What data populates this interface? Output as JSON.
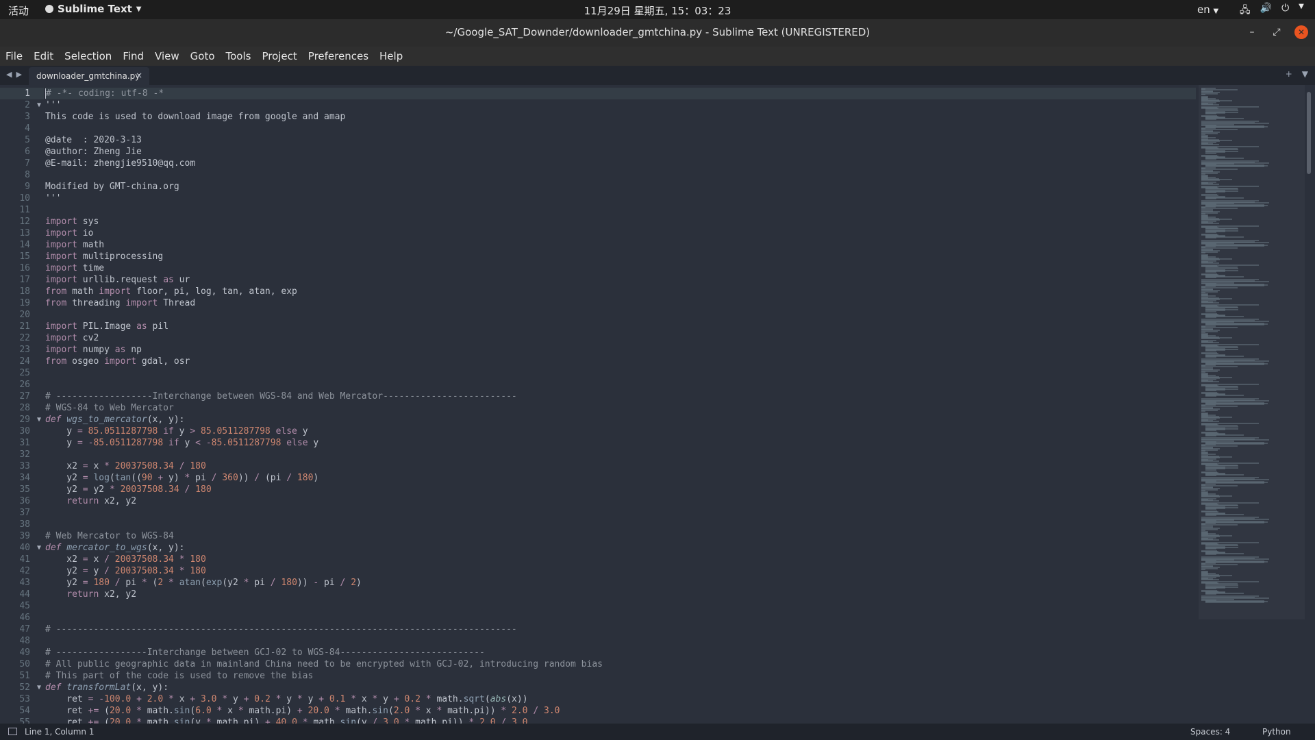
{
  "topbar": {
    "activities": "活动",
    "app_name": "Sublime Text",
    "clock": "11月29日 星期五, 15：03：23",
    "language": "en"
  },
  "window": {
    "title": "~/Google_SAT_Downder/downloader_gmtchina.py - Sublime Text (UNREGISTERED)"
  },
  "menu": [
    "File",
    "Edit",
    "Selection",
    "Find",
    "View",
    "Goto",
    "Tools",
    "Project",
    "Preferences",
    "Help"
  ],
  "tabs": [
    {
      "label": "downloader_gmtchina.py",
      "close": "×"
    }
  ],
  "statusbar": {
    "position": "Line 1, Column 1",
    "indent": "Spaces: 4",
    "syntax": "Python"
  },
  "editor": {
    "active_line": 1,
    "fold_lines": [
      2,
      29,
      40,
      52
    ],
    "lines": [
      [
        [
          "comment",
          "# -*- coding: utf-8 -*"
        ]
      ],
      [
        [
          "text",
          "'''"
        ]
      ],
      [
        [
          "text",
          "This code is used to download image from google and amap"
        ]
      ],
      [],
      [
        [
          "text",
          "@date  : 2020-3-13"
        ]
      ],
      [
        [
          "text",
          "@author: Zheng Jie"
        ]
      ],
      [
        [
          "text",
          "@E-mail: zhengjie9510@qq.com"
        ]
      ],
      [],
      [
        [
          "text",
          "Modified by GMT-china.org"
        ]
      ],
      [
        [
          "text",
          "'''"
        ]
      ],
      [],
      [
        [
          "kw",
          "import"
        ],
        [
          "text",
          " sys"
        ]
      ],
      [
        [
          "kw",
          "import"
        ],
        [
          "text",
          " io"
        ]
      ],
      [
        [
          "kw",
          "import"
        ],
        [
          "text",
          " math"
        ]
      ],
      [
        [
          "kw",
          "import"
        ],
        [
          "text",
          " multiprocessing"
        ]
      ],
      [
        [
          "kw",
          "import"
        ],
        [
          "text",
          " time"
        ]
      ],
      [
        [
          "kw",
          "import"
        ],
        [
          "text",
          " urllib.request "
        ],
        [
          "kw",
          "as"
        ],
        [
          "text",
          " ur"
        ]
      ],
      [
        [
          "kw",
          "from"
        ],
        [
          "text",
          " math "
        ],
        [
          "kw",
          "import"
        ],
        [
          "text",
          " floor, pi, log, tan, atan, exp"
        ]
      ],
      [
        [
          "kw",
          "from"
        ],
        [
          "text",
          " threading "
        ],
        [
          "kw",
          "import"
        ],
        [
          "text",
          " Thread"
        ]
      ],
      [],
      [
        [
          "kw",
          "import"
        ],
        [
          "text",
          " PIL.Image "
        ],
        [
          "kw",
          "as"
        ],
        [
          "text",
          " pil"
        ]
      ],
      [
        [
          "kw",
          "import"
        ],
        [
          "text",
          " cv2"
        ]
      ],
      [
        [
          "kw",
          "import"
        ],
        [
          "text",
          " numpy "
        ],
        [
          "kw",
          "as"
        ],
        [
          "text",
          " np"
        ]
      ],
      [
        [
          "kw",
          "from"
        ],
        [
          "text",
          " osgeo "
        ],
        [
          "kw",
          "import"
        ],
        [
          "text",
          " gdal, osr"
        ]
      ],
      [],
      [],
      [
        [
          "comment",
          "# ------------------Interchange between WGS-84 and Web Mercator-------------------------"
        ]
      ],
      [
        [
          "comment",
          "# WGS-84 to Web Mercator"
        ]
      ],
      [
        [
          "def",
          "def"
        ],
        [
          "text",
          " "
        ],
        [
          "deffn",
          "wgs_to_mercator"
        ],
        [
          "text",
          "(x, y):"
        ]
      ],
      [
        [
          "text",
          "    y "
        ],
        [
          "kw",
          "="
        ],
        [
          "text",
          " "
        ],
        [
          "num",
          "85.0511287798"
        ],
        [
          "text",
          " "
        ],
        [
          "kw",
          "if"
        ],
        [
          "text",
          " y "
        ],
        [
          "kw",
          ">"
        ],
        [
          "text",
          " "
        ],
        [
          "num",
          "85.0511287798"
        ],
        [
          "text",
          " "
        ],
        [
          "kw",
          "else"
        ],
        [
          "text",
          " y"
        ]
      ],
      [
        [
          "text",
          "    y "
        ],
        [
          "kw",
          "="
        ],
        [
          "text",
          " "
        ],
        [
          "kw",
          "-"
        ],
        [
          "num",
          "85.0511287798"
        ],
        [
          "text",
          " "
        ],
        [
          "kw",
          "if"
        ],
        [
          "text",
          " y "
        ],
        [
          "kw",
          "<"
        ],
        [
          "text",
          " "
        ],
        [
          "kw",
          "-"
        ],
        [
          "num",
          "85.0511287798"
        ],
        [
          "text",
          " "
        ],
        [
          "kw",
          "else"
        ],
        [
          "text",
          " y"
        ]
      ],
      [],
      [
        [
          "text",
          "    x2 "
        ],
        [
          "kw",
          "="
        ],
        [
          "text",
          " x "
        ],
        [
          "kw",
          "*"
        ],
        [
          "text",
          " "
        ],
        [
          "num",
          "20037508.34"
        ],
        [
          "text",
          " "
        ],
        [
          "kw",
          "/"
        ],
        [
          "text",
          " "
        ],
        [
          "num",
          "180"
        ]
      ],
      [
        [
          "text",
          "    y2 "
        ],
        [
          "kw",
          "="
        ],
        [
          "text",
          " "
        ],
        [
          "fn",
          "log"
        ],
        [
          "text",
          "("
        ],
        [
          "fn",
          "tan"
        ],
        [
          "text",
          "(("
        ],
        [
          "num",
          "90"
        ],
        [
          "text",
          " "
        ],
        [
          "kw",
          "+"
        ],
        [
          "text",
          " y) "
        ],
        [
          "kw",
          "*"
        ],
        [
          "text",
          " pi "
        ],
        [
          "kw",
          "/"
        ],
        [
          "text",
          " "
        ],
        [
          "num",
          "360"
        ],
        [
          "text",
          ")) "
        ],
        [
          "kw",
          "/"
        ],
        [
          "text",
          " (pi "
        ],
        [
          "kw",
          "/"
        ],
        [
          "text",
          " "
        ],
        [
          "num",
          "180"
        ],
        [
          "text",
          ")"
        ]
      ],
      [
        [
          "text",
          "    y2 "
        ],
        [
          "kw",
          "="
        ],
        [
          "text",
          " y2 "
        ],
        [
          "kw",
          "*"
        ],
        [
          "text",
          " "
        ],
        [
          "num",
          "20037508.34"
        ],
        [
          "text",
          " "
        ],
        [
          "kw",
          "/"
        ],
        [
          "text",
          " "
        ],
        [
          "num",
          "180"
        ]
      ],
      [
        [
          "text",
          "    "
        ],
        [
          "kw",
          "return"
        ],
        [
          "text",
          " x2, y2"
        ]
      ],
      [],
      [],
      [
        [
          "comment",
          "# Web Mercator to WGS-84"
        ]
      ],
      [
        [
          "def",
          "def"
        ],
        [
          "text",
          " "
        ],
        [
          "deffn",
          "mercator_to_wgs"
        ],
        [
          "text",
          "(x, y):"
        ]
      ],
      [
        [
          "text",
          "    x2 "
        ],
        [
          "kw",
          "="
        ],
        [
          "text",
          " x "
        ],
        [
          "kw",
          "/"
        ],
        [
          "text",
          " "
        ],
        [
          "num",
          "20037508.34"
        ],
        [
          "text",
          " "
        ],
        [
          "kw",
          "*"
        ],
        [
          "text",
          " "
        ],
        [
          "num",
          "180"
        ]
      ],
      [
        [
          "text",
          "    y2 "
        ],
        [
          "kw",
          "="
        ],
        [
          "text",
          " y "
        ],
        [
          "kw",
          "/"
        ],
        [
          "text",
          " "
        ],
        [
          "num",
          "20037508.34"
        ],
        [
          "text",
          " "
        ],
        [
          "kw",
          "*"
        ],
        [
          "text",
          " "
        ],
        [
          "num",
          "180"
        ]
      ],
      [
        [
          "text",
          "    y2 "
        ],
        [
          "kw",
          "="
        ],
        [
          "text",
          " "
        ],
        [
          "num",
          "180"
        ],
        [
          "text",
          " "
        ],
        [
          "kw",
          "/"
        ],
        [
          "text",
          " pi "
        ],
        [
          "kw",
          "*"
        ],
        [
          "text",
          " ("
        ],
        [
          "num",
          "2"
        ],
        [
          "text",
          " "
        ],
        [
          "kw",
          "*"
        ],
        [
          "text",
          " "
        ],
        [
          "fn",
          "atan"
        ],
        [
          "text",
          "("
        ],
        [
          "fn",
          "exp"
        ],
        [
          "text",
          "(y2 "
        ],
        [
          "kw",
          "*"
        ],
        [
          "text",
          " pi "
        ],
        [
          "kw",
          "/"
        ],
        [
          "text",
          " "
        ],
        [
          "num",
          "180"
        ],
        [
          "text",
          ")) "
        ],
        [
          "kw",
          "-"
        ],
        [
          "text",
          " pi "
        ],
        [
          "kw",
          "/"
        ],
        [
          "text",
          " "
        ],
        [
          "num",
          "2"
        ],
        [
          "text",
          ")"
        ]
      ],
      [
        [
          "text",
          "    "
        ],
        [
          "kw",
          "return"
        ],
        [
          "text",
          " x2, y2"
        ]
      ],
      [],
      [],
      [
        [
          "comment",
          "# --------------------------------------------------------------------------------------"
        ]
      ],
      [],
      [
        [
          "comment",
          "# -----------------Interchange between GCJ-02 to WGS-84---------------------------"
        ]
      ],
      [
        [
          "comment",
          "# All public geographic data in mainland China need to be encrypted with GCJ-02, introducing random bias"
        ]
      ],
      [
        [
          "comment",
          "# This part of the code is used to remove the bias"
        ]
      ],
      [
        [
          "def",
          "def"
        ],
        [
          "text",
          " "
        ],
        [
          "deffn",
          "transformLat"
        ],
        [
          "text",
          "(x, y):"
        ]
      ],
      [
        [
          "text",
          "    ret "
        ],
        [
          "kw",
          "="
        ],
        [
          "text",
          " "
        ],
        [
          "kw",
          "-"
        ],
        [
          "num",
          "100.0"
        ],
        [
          "text",
          " "
        ],
        [
          "kw",
          "+"
        ],
        [
          "text",
          " "
        ],
        [
          "num",
          "2.0"
        ],
        [
          "text",
          " "
        ],
        [
          "kw",
          "*"
        ],
        [
          "text",
          " x "
        ],
        [
          "kw",
          "+"
        ],
        [
          "text",
          " "
        ],
        [
          "num",
          "3.0"
        ],
        [
          "text",
          " "
        ],
        [
          "kw",
          "*"
        ],
        [
          "text",
          " y "
        ],
        [
          "kw",
          "+"
        ],
        [
          "text",
          " "
        ],
        [
          "num",
          "0.2"
        ],
        [
          "text",
          " "
        ],
        [
          "kw",
          "*"
        ],
        [
          "text",
          " y "
        ],
        [
          "kw",
          "*"
        ],
        [
          "text",
          " y "
        ],
        [
          "kw",
          "+"
        ],
        [
          "text",
          " "
        ],
        [
          "num",
          "0.1"
        ],
        [
          "text",
          " "
        ],
        [
          "kw",
          "*"
        ],
        [
          "text",
          " x "
        ],
        [
          "kw",
          "*"
        ],
        [
          "text",
          " y "
        ],
        [
          "kw",
          "+"
        ],
        [
          "text",
          " "
        ],
        [
          "num",
          "0.2"
        ],
        [
          "text",
          " "
        ],
        [
          "kw",
          "*"
        ],
        [
          "text",
          " math."
        ],
        [
          "fn",
          "sqrt"
        ],
        [
          "text",
          "("
        ],
        [
          "builtin",
          "abs"
        ],
        [
          "text",
          "(x))"
        ]
      ],
      [
        [
          "text",
          "    ret "
        ],
        [
          "kw",
          "+="
        ],
        [
          "text",
          " ("
        ],
        [
          "num",
          "20.0"
        ],
        [
          "text",
          " "
        ],
        [
          "kw",
          "*"
        ],
        [
          "text",
          " math."
        ],
        [
          "fn",
          "sin"
        ],
        [
          "text",
          "("
        ],
        [
          "num",
          "6.0"
        ],
        [
          "text",
          " "
        ],
        [
          "kw",
          "*"
        ],
        [
          "text",
          " x "
        ],
        [
          "kw",
          "*"
        ],
        [
          "text",
          " math.pi) "
        ],
        [
          "kw",
          "+"
        ],
        [
          "text",
          " "
        ],
        [
          "num",
          "20.0"
        ],
        [
          "text",
          " "
        ],
        [
          "kw",
          "*"
        ],
        [
          "text",
          " math."
        ],
        [
          "fn",
          "sin"
        ],
        [
          "text",
          "("
        ],
        [
          "num",
          "2.0"
        ],
        [
          "text",
          " "
        ],
        [
          "kw",
          "*"
        ],
        [
          "text",
          " x "
        ],
        [
          "kw",
          "*"
        ],
        [
          "text",
          " math.pi)) "
        ],
        [
          "kw",
          "*"
        ],
        [
          "text",
          " "
        ],
        [
          "num",
          "2.0"
        ],
        [
          "text",
          " "
        ],
        [
          "kw",
          "/"
        ],
        [
          "text",
          " "
        ],
        [
          "num",
          "3.0"
        ]
      ],
      [
        [
          "text",
          "    ret "
        ],
        [
          "kw",
          "+="
        ],
        [
          "text",
          " ("
        ],
        [
          "num",
          "20.0"
        ],
        [
          "text",
          " "
        ],
        [
          "kw",
          "*"
        ],
        [
          "text",
          " math."
        ],
        [
          "fn",
          "sin"
        ],
        [
          "text",
          "(y "
        ],
        [
          "kw",
          "*"
        ],
        [
          "text",
          " math.pi) "
        ],
        [
          "kw",
          "+"
        ],
        [
          "text",
          " "
        ],
        [
          "num",
          "40.0"
        ],
        [
          "text",
          " "
        ],
        [
          "kw",
          "*"
        ],
        [
          "text",
          " math."
        ],
        [
          "fn",
          "sin"
        ],
        [
          "text",
          "(y "
        ],
        [
          "kw",
          "/"
        ],
        [
          "text",
          " "
        ],
        [
          "num",
          "3.0"
        ],
        [
          "text",
          " "
        ],
        [
          "kw",
          "*"
        ],
        [
          "text",
          " math.pi)) "
        ],
        [
          "kw",
          "*"
        ],
        [
          "text",
          " "
        ],
        [
          "num",
          "2.0"
        ],
        [
          "text",
          " "
        ],
        [
          "kw",
          "/"
        ],
        [
          "text",
          " "
        ],
        [
          "num",
          "3.0"
        ]
      ]
    ]
  }
}
